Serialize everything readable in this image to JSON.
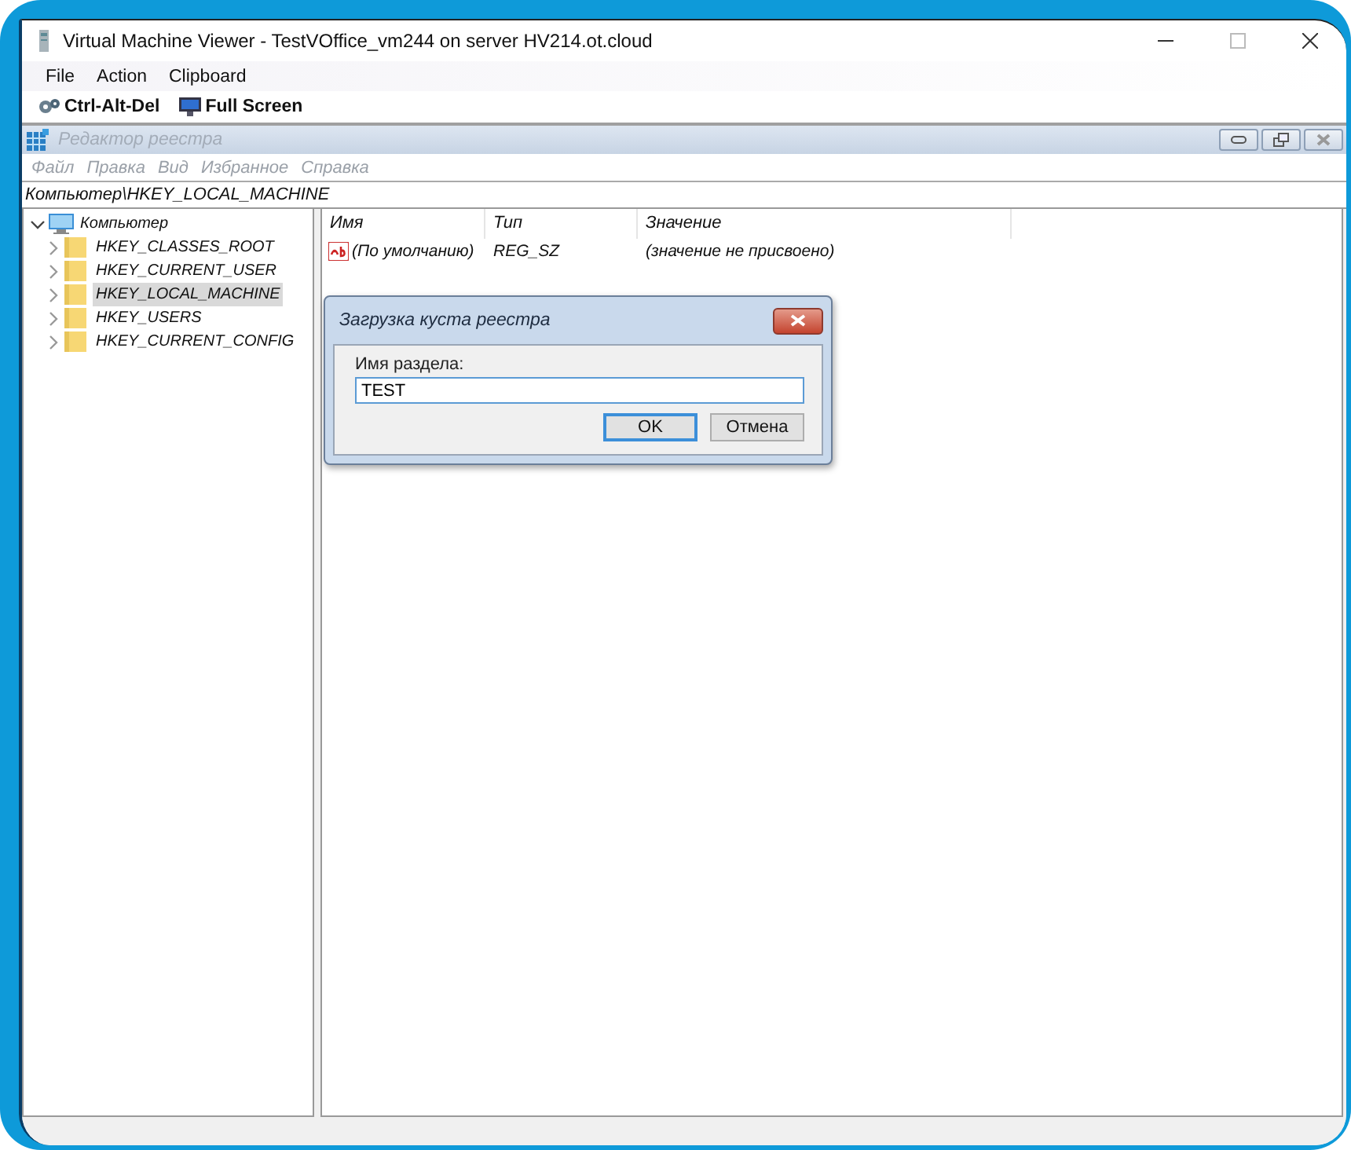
{
  "window": {
    "title": "Virtual Machine Viewer - TestVOffice_vm244 on server HV214.ot.cloud"
  },
  "menu": [
    "File",
    "Action",
    "Clipboard"
  ],
  "toolbar": [
    {
      "kind": "keys",
      "label": "Ctrl-Alt-Del"
    },
    {
      "kind": "screen",
      "label": "Full Screen"
    }
  ],
  "regedit": {
    "title": "Редактор реестра",
    "menu": [
      "Файл",
      "Правка",
      "Вид",
      "Избранное",
      "Справка"
    ],
    "address": "Компьютер\\HKEY_LOCAL_MACHINE",
    "tree": [
      {
        "label": "Компьютер",
        "kind": "computer",
        "expanded": true,
        "selected": false,
        "children": [
          {
            "label": "HKEY_CLASSES_ROOT",
            "kind": "folder",
            "expanded": false,
            "selected": false
          },
          {
            "label": "HKEY_CURRENT_USER",
            "kind": "folder",
            "expanded": false,
            "selected": false
          },
          {
            "label": "HKEY_LOCAL_MACHINE",
            "kind": "folder",
            "expanded": false,
            "selected": true
          },
          {
            "label": "HKEY_USERS",
            "kind": "folder",
            "expanded": false,
            "selected": false
          },
          {
            "label": "HKEY_CURRENT_CONFIG",
            "kind": "folder",
            "expanded": false,
            "selected": false
          }
        ]
      }
    ],
    "columns": [
      "Имя",
      "Тип",
      "Значение"
    ],
    "rows": [
      {
        "name": "(По умолчанию)",
        "type": "REG_SZ",
        "value": "(значение не присвоено)"
      }
    ]
  },
  "dialog": {
    "title": "Загрузка куста реестра",
    "label": "Имя раздела:",
    "value": "TEST",
    "buttons": [
      {
        "label": "OK",
        "default": true
      },
      {
        "label": "Отмена",
        "default": false
      }
    ]
  }
}
